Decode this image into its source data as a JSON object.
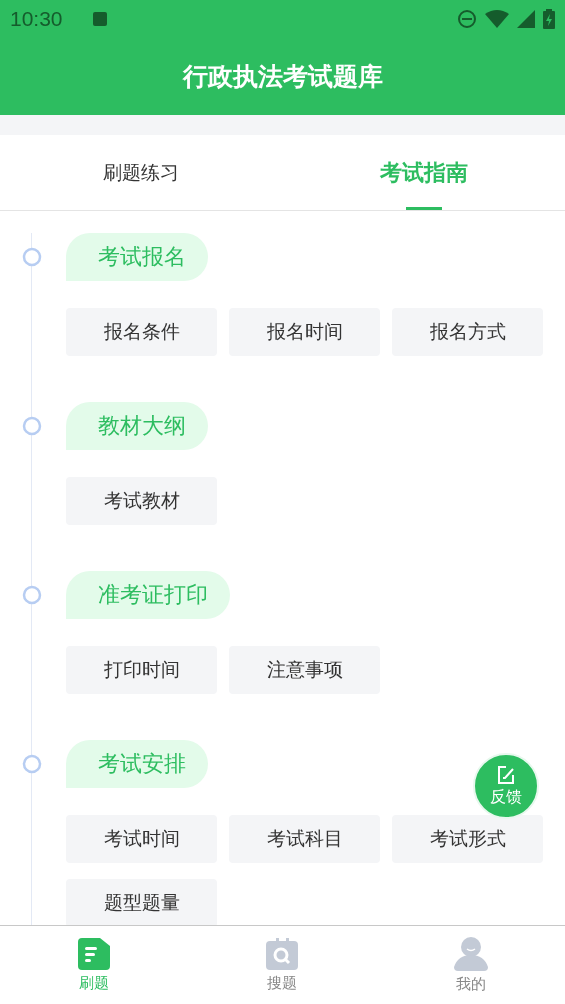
{
  "status_bar": {
    "time": "10:30"
  },
  "header": {
    "title": "行政执法考试题库"
  },
  "tabs": [
    {
      "label": "刷题练习",
      "selected": false
    },
    {
      "label": "考试指南",
      "selected": true
    }
  ],
  "sections": [
    {
      "title": "考试报名",
      "items": [
        "报名条件",
        "报名时间",
        "报名方式"
      ]
    },
    {
      "title": "教材大纲",
      "items": [
        "考试教材"
      ]
    },
    {
      "title": "准考证打印",
      "items": [
        "打印时间",
        "注意事项"
      ]
    },
    {
      "title": "考试安排",
      "items": [
        "考试时间",
        "考试科目",
        "考试形式",
        "题型题量"
      ]
    }
  ],
  "feedback_button": {
    "label": "反馈"
  },
  "bottom_nav": [
    {
      "label": "刷题",
      "selected": true,
      "kind": "doc"
    },
    {
      "label": "搜题",
      "selected": false,
      "kind": "search"
    },
    {
      "label": "我的",
      "selected": false,
      "kind": "user"
    }
  ]
}
